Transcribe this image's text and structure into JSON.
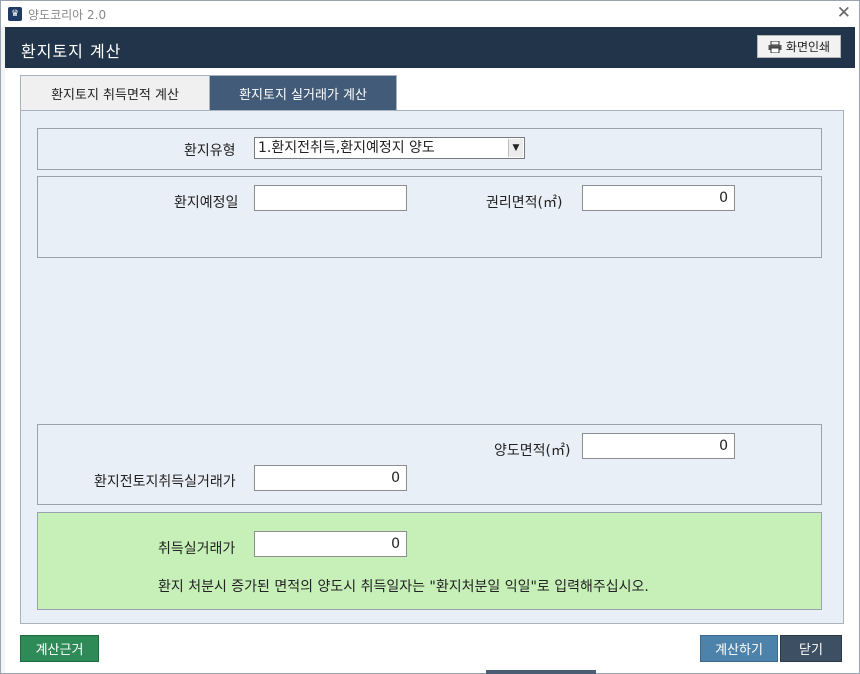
{
  "window": {
    "app_title": "양도코리아 2.0",
    "close_glyph": "✕"
  },
  "header": {
    "title": "환지토지 계산",
    "print_label": "화면인쇄"
  },
  "tabs": [
    {
      "label": "환지토지 취득면적 계산",
      "active": false
    },
    {
      "label": "환지토지 실거래가 계산",
      "active": true
    }
  ],
  "form": {
    "type_label": "환지유형",
    "type_value": "1.환지전취득,환지예정지 양도",
    "scheduled_date_label": "환지예정일",
    "scheduled_date_value": "",
    "rights_area_label": "권리면적(㎡)",
    "rights_area_value": "0",
    "transfer_area_label": "양도면적(㎡)",
    "transfer_area_value": "0",
    "pre_acq_price_label": "환지전토지취득실거래가",
    "pre_acq_price_value": "0",
    "acq_price_label": "취득실거래가",
    "acq_price_value": "0",
    "note": "환지 처분시 증가된 면적의 양도시 취득일자는 \"환지처분일 익일\"로 입력해주십시오."
  },
  "buttons": {
    "basis": "계산근거",
    "calculate": "계산하기",
    "close": "닫기"
  },
  "colors": {
    "header_bg": "#213449",
    "active_tab": "#425b78",
    "content_bg": "#e9eff6",
    "result_bg": "#c6f0b8",
    "basis_btn": "#2e8b57",
    "calc_btn": "#4d82ab",
    "close_btn": "#3c4f63"
  }
}
